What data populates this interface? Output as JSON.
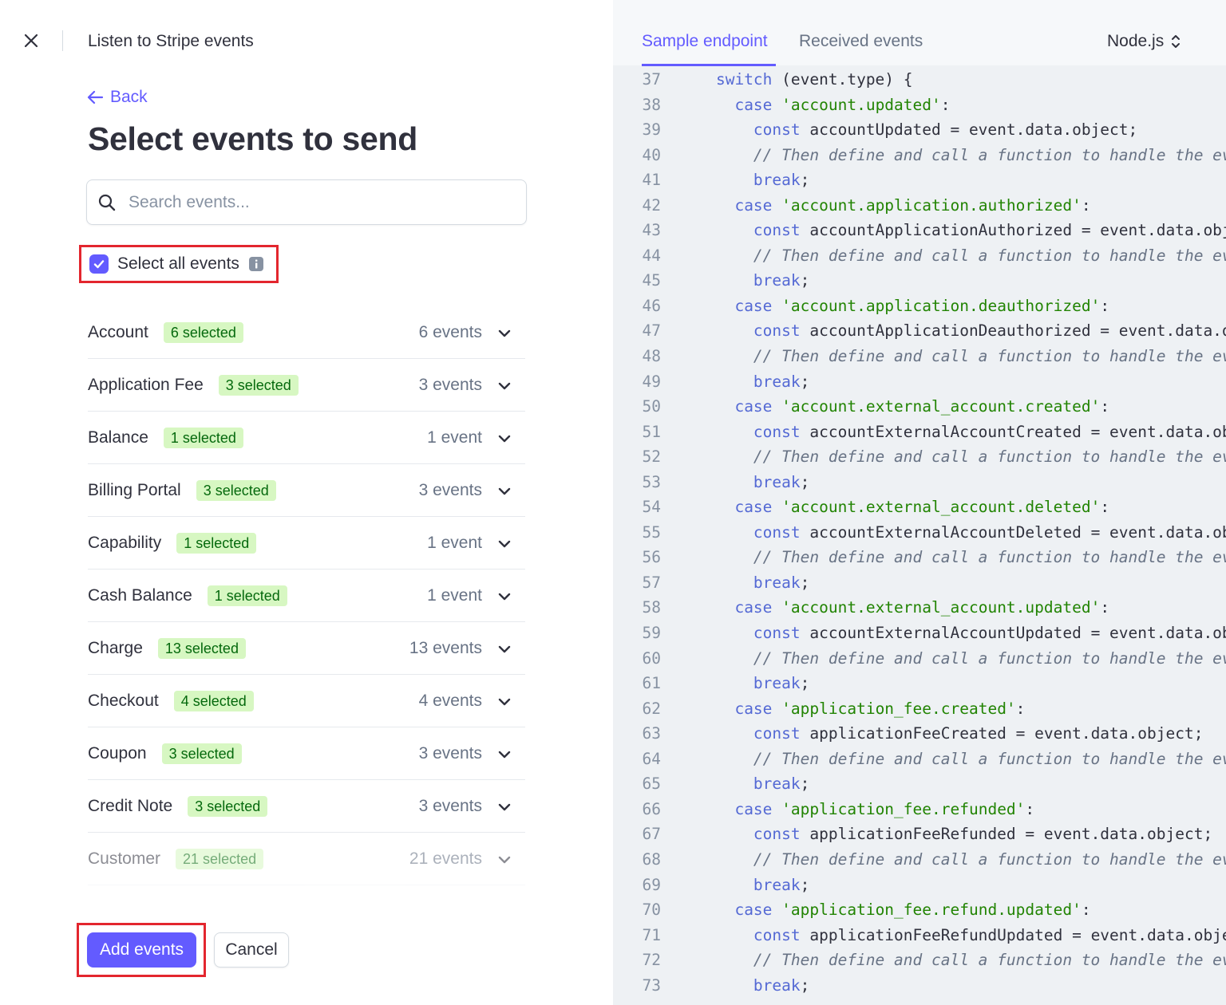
{
  "header": {
    "title": "Listen to Stripe events"
  },
  "back_label": "Back",
  "heading": "Select events to send",
  "search": {
    "placeholder": "Search events...",
    "value": ""
  },
  "select_all": {
    "label": "Select all events",
    "checked": true
  },
  "groups": [
    {
      "name": "Account",
      "badge": "6 selected",
      "count": "6 events"
    },
    {
      "name": "Application Fee",
      "badge": "3 selected",
      "count": "3 events"
    },
    {
      "name": "Balance",
      "badge": "1 selected",
      "count": "1 event"
    },
    {
      "name": "Billing Portal",
      "badge": "3 selected",
      "count": "3 events"
    },
    {
      "name": "Capability",
      "badge": "1 selected",
      "count": "1 event"
    },
    {
      "name": "Cash Balance",
      "badge": "1 selected",
      "count": "1 event"
    },
    {
      "name": "Charge",
      "badge": "13 selected",
      "count": "13 events"
    },
    {
      "name": "Checkout",
      "badge": "4 selected",
      "count": "4 events"
    },
    {
      "name": "Coupon",
      "badge": "3 selected",
      "count": "3 events"
    },
    {
      "name": "Credit Note",
      "badge": "3 selected",
      "count": "3 events"
    },
    {
      "name": "Customer",
      "badge": "21 selected",
      "count": "21 events"
    }
  ],
  "buttons": {
    "add_events": "Add events",
    "cancel": "Cancel"
  },
  "code_panel": {
    "tabs": [
      "Sample endpoint",
      "Received events"
    ],
    "active_tab": "Sample endpoint",
    "language": "Node.js",
    "lines": [
      {
        "n": "37",
        "indent": 2,
        "parts": [
          [
            "kw",
            "switch"
          ],
          [
            "t",
            " (event.type) {"
          ]
        ]
      },
      {
        "n": "38",
        "indent": 3,
        "parts": [
          [
            "kw",
            "case"
          ],
          [
            "t",
            " "
          ],
          [
            "str",
            "'account.updated'"
          ],
          [
            "t",
            ":"
          ]
        ]
      },
      {
        "n": "39",
        "indent": 4,
        "parts": [
          [
            "kw",
            "const"
          ],
          [
            "t",
            " accountUpdated = event.data.object;"
          ]
        ]
      },
      {
        "n": "40",
        "indent": 4,
        "parts": [
          [
            "cm",
            "// Then define and call a function to handle the ev"
          ]
        ]
      },
      {
        "n": "41",
        "indent": 4,
        "parts": [
          [
            "kw",
            "break"
          ],
          [
            "t",
            ";"
          ]
        ]
      },
      {
        "n": "42",
        "indent": 3,
        "parts": [
          [
            "kw",
            "case"
          ],
          [
            "t",
            " "
          ],
          [
            "str",
            "'account.application.authorized'"
          ],
          [
            "t",
            ":"
          ]
        ]
      },
      {
        "n": "43",
        "indent": 4,
        "parts": [
          [
            "kw",
            "const"
          ],
          [
            "t",
            " accountApplicationAuthorized = event.data.obj"
          ]
        ]
      },
      {
        "n": "44",
        "indent": 4,
        "parts": [
          [
            "cm",
            "// Then define and call a function to handle the ev"
          ]
        ]
      },
      {
        "n": "45",
        "indent": 4,
        "parts": [
          [
            "kw",
            "break"
          ],
          [
            "t",
            ";"
          ]
        ]
      },
      {
        "n": "46",
        "indent": 3,
        "parts": [
          [
            "kw",
            "case"
          ],
          [
            "t",
            " "
          ],
          [
            "str",
            "'account.application.deauthorized'"
          ],
          [
            "t",
            ":"
          ]
        ]
      },
      {
        "n": "47",
        "indent": 4,
        "parts": [
          [
            "kw",
            "const"
          ],
          [
            "t",
            " accountApplicationDeauthorized = event.data.o"
          ]
        ]
      },
      {
        "n": "48",
        "indent": 4,
        "parts": [
          [
            "cm",
            "// Then define and call a function to handle the ev"
          ]
        ]
      },
      {
        "n": "49",
        "indent": 4,
        "parts": [
          [
            "kw",
            "break"
          ],
          [
            "t",
            ";"
          ]
        ]
      },
      {
        "n": "50",
        "indent": 3,
        "parts": [
          [
            "kw",
            "case"
          ],
          [
            "t",
            " "
          ],
          [
            "str",
            "'account.external_account.created'"
          ],
          [
            "t",
            ":"
          ]
        ]
      },
      {
        "n": "51",
        "indent": 4,
        "parts": [
          [
            "kw",
            "const"
          ],
          [
            "t",
            " accountExternalAccountCreated = event.data.ob"
          ]
        ]
      },
      {
        "n": "52",
        "indent": 4,
        "parts": [
          [
            "cm",
            "// Then define and call a function to handle the ev"
          ]
        ]
      },
      {
        "n": "53",
        "indent": 4,
        "parts": [
          [
            "kw",
            "break"
          ],
          [
            "t",
            ";"
          ]
        ]
      },
      {
        "n": "54",
        "indent": 3,
        "parts": [
          [
            "kw",
            "case"
          ],
          [
            "t",
            " "
          ],
          [
            "str",
            "'account.external_account.deleted'"
          ],
          [
            "t",
            ":"
          ]
        ]
      },
      {
        "n": "55",
        "indent": 4,
        "parts": [
          [
            "kw",
            "const"
          ],
          [
            "t",
            " accountExternalAccountDeleted = event.data.ob"
          ]
        ]
      },
      {
        "n": "56",
        "indent": 4,
        "parts": [
          [
            "cm",
            "// Then define and call a function to handle the ev"
          ]
        ]
      },
      {
        "n": "57",
        "indent": 4,
        "parts": [
          [
            "kw",
            "break"
          ],
          [
            "t",
            ";"
          ]
        ]
      },
      {
        "n": "58",
        "indent": 3,
        "parts": [
          [
            "kw",
            "case"
          ],
          [
            "t",
            " "
          ],
          [
            "str",
            "'account.external_account.updated'"
          ],
          [
            "t",
            ":"
          ]
        ]
      },
      {
        "n": "59",
        "indent": 4,
        "parts": [
          [
            "kw",
            "const"
          ],
          [
            "t",
            " accountExternalAccountUpdated = event.data.ob"
          ]
        ]
      },
      {
        "n": "60",
        "indent": 4,
        "parts": [
          [
            "cm",
            "// Then define and call a function to handle the ev"
          ]
        ]
      },
      {
        "n": "61",
        "indent": 4,
        "parts": [
          [
            "kw",
            "break"
          ],
          [
            "t",
            ";"
          ]
        ]
      },
      {
        "n": "62",
        "indent": 3,
        "parts": [
          [
            "kw",
            "case"
          ],
          [
            "t",
            " "
          ],
          [
            "str",
            "'application_fee.created'"
          ],
          [
            "t",
            ":"
          ]
        ]
      },
      {
        "n": "63",
        "indent": 4,
        "parts": [
          [
            "kw",
            "const"
          ],
          [
            "t",
            " applicationFeeCreated = event.data.object;"
          ]
        ]
      },
      {
        "n": "64",
        "indent": 4,
        "parts": [
          [
            "cm",
            "// Then define and call a function to handle the ev"
          ]
        ]
      },
      {
        "n": "65",
        "indent": 4,
        "parts": [
          [
            "kw",
            "break"
          ],
          [
            "t",
            ";"
          ]
        ]
      },
      {
        "n": "66",
        "indent": 3,
        "parts": [
          [
            "kw",
            "case"
          ],
          [
            "t",
            " "
          ],
          [
            "str",
            "'application_fee.refunded'"
          ],
          [
            "t",
            ":"
          ]
        ]
      },
      {
        "n": "67",
        "indent": 4,
        "parts": [
          [
            "kw",
            "const"
          ],
          [
            "t",
            " applicationFeeRefunded = event.data.object;"
          ]
        ]
      },
      {
        "n": "68",
        "indent": 4,
        "parts": [
          [
            "cm",
            "// Then define and call a function to handle the ev"
          ]
        ]
      },
      {
        "n": "69",
        "indent": 4,
        "parts": [
          [
            "kw",
            "break"
          ],
          [
            "t",
            ";"
          ]
        ]
      },
      {
        "n": "70",
        "indent": 3,
        "parts": [
          [
            "kw",
            "case"
          ],
          [
            "t",
            " "
          ],
          [
            "str",
            "'application_fee.refund.updated'"
          ],
          [
            "t",
            ":"
          ]
        ]
      },
      {
        "n": "71",
        "indent": 4,
        "parts": [
          [
            "kw",
            "const"
          ],
          [
            "t",
            " applicationFeeRefundUpdated = event.data.obje"
          ]
        ]
      },
      {
        "n": "72",
        "indent": 4,
        "parts": [
          [
            "cm",
            "// Then define and call a function to handle the ev"
          ]
        ]
      },
      {
        "n": "73",
        "indent": 4,
        "parts": [
          [
            "kw",
            "break"
          ],
          [
            "t",
            ";"
          ]
        ]
      }
    ]
  },
  "colors": {
    "accent": "#635bff",
    "badge_bg": "#d7f7c2",
    "badge_text": "#05690d",
    "highlight_border": "#e3262e",
    "code_bg": "#eef1f4"
  },
  "icons": [
    "close-icon",
    "arrow-left-icon",
    "search-icon",
    "check-icon",
    "info-icon",
    "chevron-down-icon",
    "chevron-up-down-icon"
  ]
}
